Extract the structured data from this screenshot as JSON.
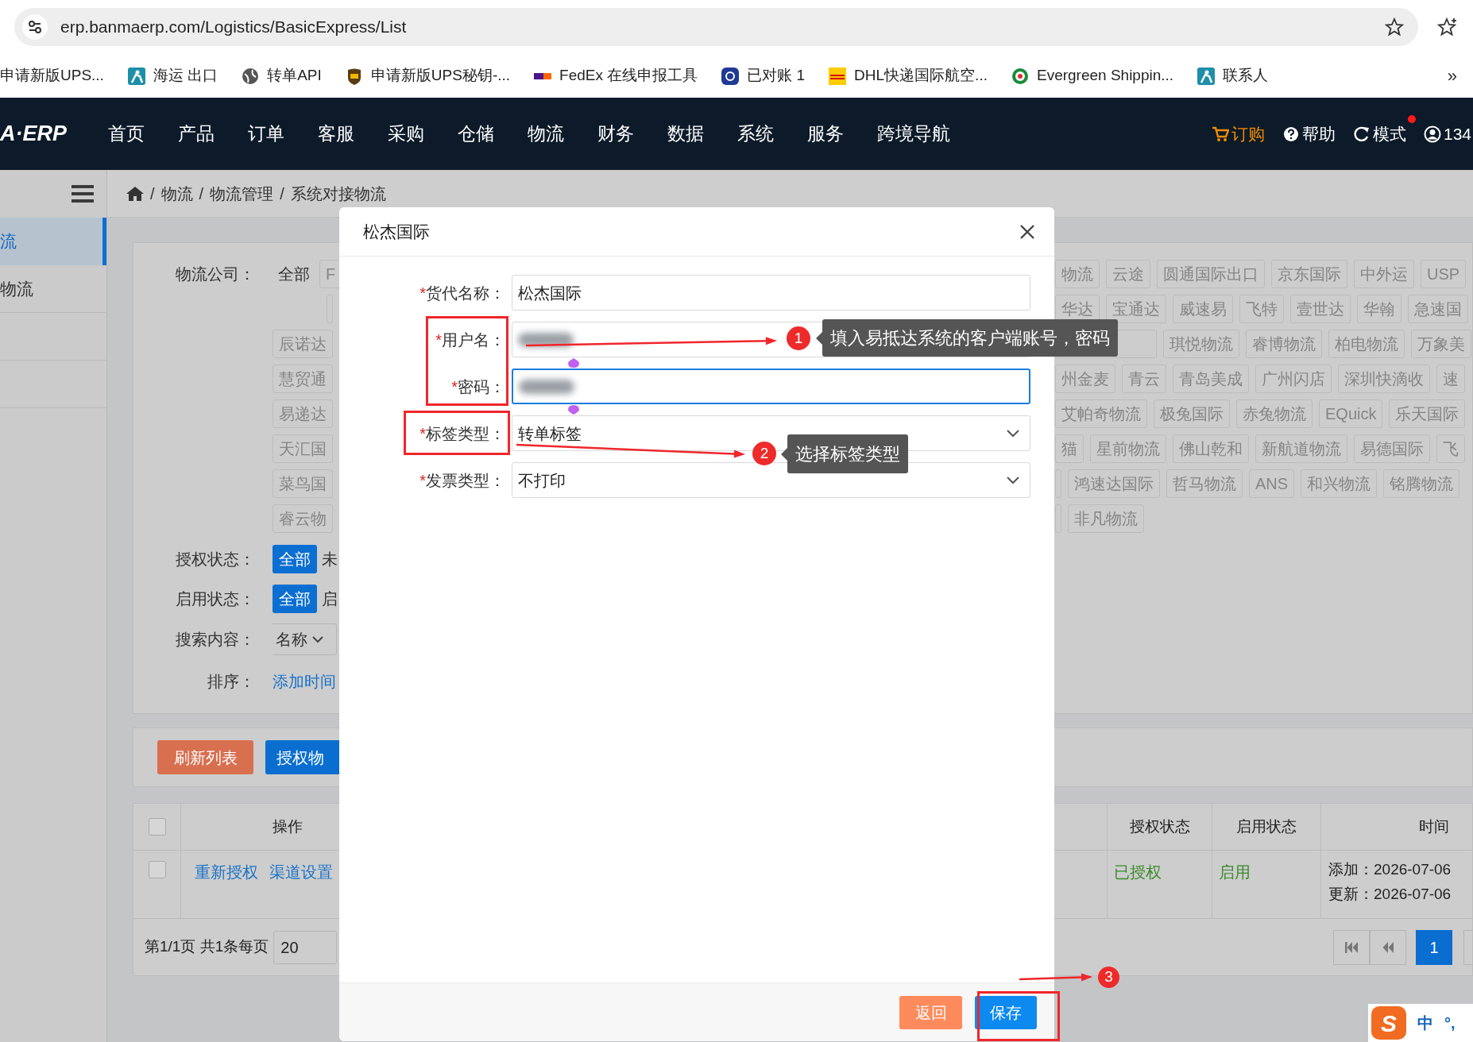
{
  "browser": {
    "url": "erp.banmaerp.com/Logistics/BasicExpress/List"
  },
  "bookmarks": [
    {
      "label": "申请新版UPS...",
      "kind": "plain"
    },
    {
      "label": "海运 出口",
      "kind": "person"
    },
    {
      "label": "转单API",
      "kind": "globe"
    },
    {
      "label": "申请新版UPS秘钥-...",
      "kind": "shield"
    },
    {
      "label": "FedEx 在线申报工具",
      "kind": "strip"
    },
    {
      "label": "已对账 1",
      "kind": "badge"
    },
    {
      "label": "DHL快递国际航空...",
      "kind": "stripes"
    },
    {
      "label": "Evergreen Shippin...",
      "kind": "seal"
    },
    {
      "label": "联系人",
      "kind": "person"
    }
  ],
  "bookmarks_more": "»",
  "nav": {
    "logo": "A·ERP",
    "items": [
      "首页",
      "产品",
      "订单",
      "客服",
      "采购",
      "仓储",
      "物流",
      "财务",
      "数据",
      "系统",
      "服务",
      "跨境导航"
    ],
    "actions": [
      {
        "label": "订购",
        "kind": "cart",
        "alert": false
      },
      {
        "label": "帮助",
        "kind": "help",
        "alert": false
      },
      {
        "label": "模式",
        "kind": "mode",
        "alert": true
      },
      {
        "label": "134",
        "kind": "user",
        "alert": false
      }
    ]
  },
  "sidebar": {
    "items": [
      {
        "label": "流",
        "selected": true
      },
      {
        "label": "物流",
        "selected": false
      }
    ]
  },
  "breadcrumb": {
    "separator": "/",
    "items": [
      "物流",
      "物流管理",
      "系统对接物流"
    ]
  },
  "filters": {
    "company_label": "物流公司：",
    "company_all": "全部",
    "left_tags": [
      [
        {
          "kind": "tag",
          "label": "F"
        }
      ],
      [
        {
          "kind": "stub"
        }
      ],
      [
        {
          "kind": "tag",
          "label": "辰诺达"
        }
      ],
      [
        {
          "kind": "tag",
          "label": "慧贸通"
        }
      ],
      [
        {
          "kind": "tag",
          "label": "易递达"
        }
      ],
      [
        {
          "kind": "tag",
          "label": "天汇国"
        }
      ],
      [
        {
          "kind": "tag",
          "label": "菜鸟国"
        }
      ],
      [
        {
          "kind": "tag",
          "label": "睿云物"
        }
      ]
    ],
    "right_tags": [
      [
        {
          "kind": "tag",
          "label": "物流"
        },
        {
          "kind": "tag",
          "label": "云途"
        },
        {
          "kind": "tag",
          "label": "圆通国际出口"
        },
        {
          "kind": "tag",
          "label": "京东国际"
        },
        {
          "kind": "tag",
          "label": "中外运"
        },
        {
          "kind": "tag",
          "label": "USP"
        }
      ],
      [
        {
          "kind": "tag",
          "label": "华达"
        },
        {
          "kind": "tag",
          "label": "宝通达"
        },
        {
          "kind": "tag",
          "label": "威速易"
        },
        {
          "kind": "tag",
          "label": "飞特"
        },
        {
          "kind": "tag",
          "label": "壹世达"
        },
        {
          "kind": "tag",
          "label": "华翰"
        },
        {
          "kind": "tag",
          "label": "急速国"
        }
      ],
      [
        {
          "kind": "covered"
        },
        {
          "kind": "tag",
          "label": "琪悦物流"
        },
        {
          "kind": "tag",
          "label": "睿博物流"
        },
        {
          "kind": "tag",
          "label": "柏电物流"
        },
        {
          "kind": "tag",
          "label": "万象美"
        }
      ],
      [
        {
          "kind": "tag",
          "label": "州金麦"
        },
        {
          "kind": "tag",
          "label": "青云"
        },
        {
          "kind": "tag",
          "label": "青岛美成"
        },
        {
          "kind": "tag",
          "label": "广州闪店"
        },
        {
          "kind": "tag",
          "label": "深圳快滴收"
        },
        {
          "kind": "tag",
          "label": "速"
        }
      ],
      [
        {
          "kind": "tag",
          "label": "艾帕奇物流"
        },
        {
          "kind": "tag",
          "label": "极兔国际"
        },
        {
          "kind": "tag",
          "label": "赤兔物流"
        },
        {
          "kind": "tag",
          "label": "EQuick"
        },
        {
          "kind": "tag",
          "label": "乐天国际"
        }
      ],
      [
        {
          "kind": "tag",
          "label": "猫"
        },
        {
          "kind": "tag",
          "label": "星前物流"
        },
        {
          "kind": "tag",
          "label": "佛山乾和"
        },
        {
          "kind": "tag",
          "label": "新航道物流"
        },
        {
          "kind": "tag",
          "label": "易德国际"
        },
        {
          "kind": "tag",
          "label": "飞"
        }
      ],
      [
        {
          "kind": "stub"
        },
        {
          "kind": "tag",
          "label": "鸿速达国际"
        },
        {
          "kind": "tag",
          "label": "哲马物流"
        },
        {
          "kind": "tag",
          "label": "ANS"
        },
        {
          "kind": "tag",
          "label": "和兴物流"
        },
        {
          "kind": "tag",
          "label": "铭腾物流"
        }
      ],
      [
        {
          "kind": "stub"
        },
        {
          "kind": "tag",
          "label": "非凡物流"
        }
      ]
    ],
    "auth": {
      "label": "授权状态：",
      "options": [
        {
          "label": "全部",
          "selected": true
        },
        {
          "label": "未",
          "selected": false
        }
      ]
    },
    "enable": {
      "label": "启用状态：",
      "options": [
        {
          "label": "全部",
          "selected": true
        },
        {
          "label": "启",
          "selected": false
        }
      ]
    },
    "search": {
      "label": "搜索内容：",
      "value": "名称"
    },
    "sort": {
      "label": "排序：",
      "value": "添加时间"
    }
  },
  "actions": [
    {
      "label": "刷新列表",
      "kind": "refresh"
    },
    {
      "label": "授权物",
      "kind": "primary"
    }
  ],
  "table": {
    "all_checked": false,
    "columns": [
      "操作",
      "授权状态",
      "启用状态",
      "时间"
    ],
    "rows": [
      {
        "checked": false,
        "links": [
          "重新授权",
          "渠道设置"
        ],
        "auth": "已授权",
        "enabled": "启用",
        "times": [
          "添加：2026-07-06",
          "更新：2026-07-06"
        ]
      }
    ]
  },
  "pager": {
    "summary": "第1/1页 共1条每页",
    "page_size": "20",
    "pages": [
      {
        "label": "1",
        "selected": true
      }
    ]
  },
  "modal": {
    "title": "松杰国际",
    "fields": [
      {
        "mark": "*",
        "label": "货代名称：",
        "kind": "input",
        "value": "松杰国际",
        "redacted": false,
        "focused": false
      },
      {
        "mark": "*",
        "label": "用户名：",
        "kind": "input",
        "redacted": true,
        "focused": false
      },
      {
        "mark": "*",
        "label": "密码：",
        "kind": "input",
        "redacted": true,
        "focused": true
      },
      {
        "mark": "*",
        "label": "标签类型：",
        "kind": "select",
        "value": "转单标签",
        "focused": false
      },
      {
        "mark": "*",
        "label": "发票类型：",
        "kind": "select",
        "value": "不打印",
        "focused": false
      }
    ],
    "buttons": [
      {
        "label": "返回",
        "kind": "back"
      },
      {
        "label": "保存",
        "kind": "primary"
      }
    ]
  },
  "callouts": [
    {
      "number": "1",
      "text": "填入易抵达系统的客户端账号，密码"
    },
    {
      "number": "2",
      "text": "选择标签类型"
    },
    {
      "number": "3"
    }
  ],
  "ime": {
    "logo": "S",
    "mode": "中",
    "punct": "°,"
  }
}
